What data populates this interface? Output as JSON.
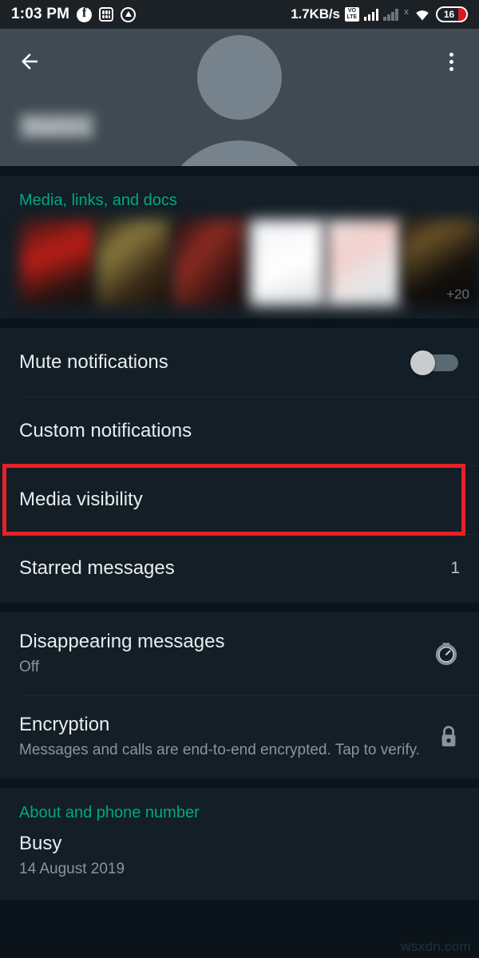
{
  "status_bar": {
    "clock": "1:03 PM",
    "network_speed": "1.7KB/s",
    "volte_label_top": "VO",
    "volte_label_bottom": "LTE",
    "sim2_x": "x",
    "battery_level": "16",
    "icons": [
      "facebook-icon",
      "app-grid-icon",
      "drop-icon",
      "volte-icon",
      "signal-bars-icon",
      "signal-bars-inactive-icon",
      "wifi-icon",
      "battery-icon"
    ]
  },
  "header": {
    "back_label": "Back",
    "menu_label": "More options",
    "contact_name": "Mahim",
    "avatar_label": "Default contact avatar"
  },
  "media_section": {
    "title": "Media, links, and docs",
    "more_count": "+20",
    "thumbnails": [
      "thumb-1",
      "thumb-2",
      "thumb-3",
      "thumb-4",
      "thumb-5",
      "thumb-6"
    ]
  },
  "notification_rows": [
    {
      "label": "Mute notifications",
      "control": "toggle",
      "toggle_state": "off"
    },
    {
      "label": "Custom notifications",
      "control": "none"
    },
    {
      "label": "Media visibility",
      "control": "none",
      "highlighted": true
    },
    {
      "label": "Starred messages",
      "control": "count",
      "count": "1"
    }
  ],
  "privacy_rows": [
    {
      "label": "Disappearing messages",
      "value": "Off",
      "icon": "timer-icon"
    },
    {
      "label": "Encryption",
      "value": "Messages and calls are end-to-end encrypted. Tap to verify.",
      "icon": "lock-icon"
    }
  ],
  "about_section": {
    "title": "About and phone number",
    "status_text": "Busy",
    "status_date": "14 August 2019"
  },
  "watermark": "wsxdn.com",
  "colors": {
    "accent_teal": "#00a884",
    "highlight_red": "#e82127",
    "surface": "#131e26",
    "background": "#0b141a",
    "header": "#3f4a52",
    "status_bar": "#1c2126"
  }
}
